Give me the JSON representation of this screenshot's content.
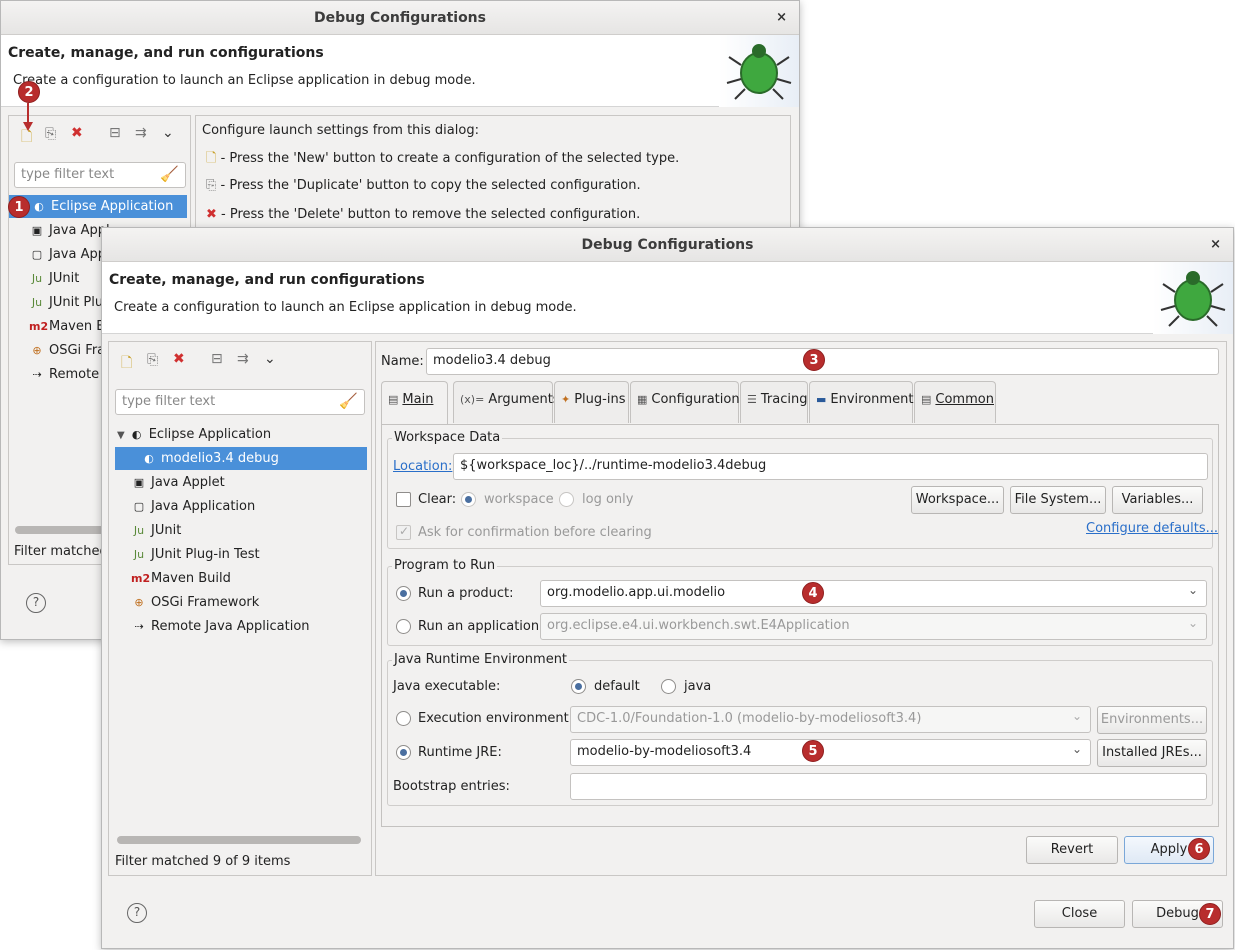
{
  "back_dialog": {
    "title": "Debug Configurations",
    "close": "×",
    "header_title": "Create, manage, and run configurations",
    "header_sub": "Create a configuration to launch an Eclipse application in debug mode.",
    "filter_placeholder": "type filter text",
    "intro": "Configure launch settings from this dialog:",
    "hints": [
      "- Press the 'New' button to create a configuration of the selected type.",
      "- Press the 'Duplicate' button to copy the selected configuration.",
      "- Press the 'Delete' button to remove the selected configuration."
    ],
    "tree": [
      "Eclipse Application",
      "Java Appl",
      "Java Appl",
      "JUnit",
      "JUnit Plug",
      "Maven Bu",
      "OSGi Fran",
      "Remote J"
    ],
    "filter_status": "Filter matched",
    "help": "?"
  },
  "front_dialog": {
    "title": "Debug Configurations",
    "close": "×",
    "header_title": "Create, manage, and run configurations",
    "header_sub": "Create a configuration to launch an Eclipse application in debug mode.",
    "filter_placeholder": "type filter text",
    "tree": [
      {
        "label": "Eclipse Application",
        "icon": "eclipse-icon"
      },
      {
        "label": "modelio3.4 debug",
        "icon": "eclipse-icon"
      },
      {
        "label": "Java Applet",
        "icon": "java-applet-icon"
      },
      {
        "label": "Java Application",
        "icon": "java-app-icon"
      },
      {
        "label": "JUnit",
        "icon": "junit-icon"
      },
      {
        "label": "JUnit Plug-in Test",
        "icon": "junit-plugin-icon"
      },
      {
        "label": "Maven Build",
        "icon": "maven-icon"
      },
      {
        "label": "OSGi Framework",
        "icon": "osgi-icon"
      },
      {
        "label": "Remote Java Application",
        "icon": "remote-java-icon"
      }
    ],
    "filter_status": "Filter matched 9 of 9 items",
    "name_label": "Name:",
    "name_value": "modelio3.4 debug",
    "tabs": {
      "main": "Main",
      "arguments": "Arguments",
      "plugins": "Plug-ins",
      "configuration": "Configuration",
      "tracing": "Tracing",
      "environment": "Environment",
      "common": "Common"
    },
    "workspace": {
      "group": "Workspace Data",
      "location_label": "Location:",
      "location_value": "${workspace_loc}/../runtime-modelio3.4debug",
      "clear": "Clear:",
      "opt_workspace": "workspace",
      "opt_log": "log only",
      "btn_workspace": "Workspace...",
      "btn_filesystem": "File System...",
      "btn_variables": "Variables...",
      "ask": "Ask for confirmation before clearing",
      "configure": "Configure defaults..."
    },
    "program": {
      "group": "Program to Run",
      "run_product": "Run a product:",
      "product_value": "org.modelio.app.ui.modelio",
      "run_app": "Run an application:",
      "app_value": "org.eclipse.e4.ui.workbench.swt.E4Application"
    },
    "jre": {
      "group": "Java Runtime Environment",
      "java_exec": "Java executable:",
      "opt_default": "default",
      "opt_java": "java",
      "exec_env": "Execution environment:",
      "exec_env_value": "CDC-1.0/Foundation-1.0 (modelio-by-modeliosoft3.4)",
      "btn_environments": "Environments...",
      "runtime_jre": "Runtime JRE:",
      "runtime_jre_value": "modelio-by-modeliosoft3.4",
      "btn_installed": "Installed JREs...",
      "bootstrap": "Bootstrap entries:",
      "bootstrap_value": ""
    },
    "btn_revert": "Revert",
    "btn_apply": "Apply",
    "btn_close": "Close",
    "btn_debug": "Debug",
    "help": "?"
  },
  "badges": [
    "1",
    "2",
    "3",
    "4",
    "5",
    "6",
    "7"
  ],
  "colors": {
    "badge": "#b82d2d",
    "selection": "#4a90d9",
    "link": "#2a6fc9"
  }
}
